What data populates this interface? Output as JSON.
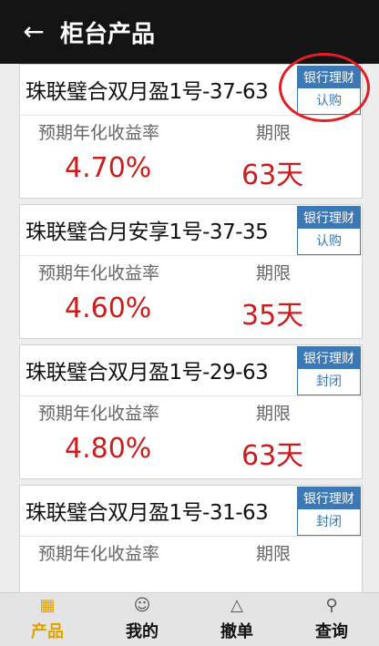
{
  "header": {
    "title": "柜台产品",
    "back_icon": "arrow-left-icon"
  },
  "products": [
    {
      "name": "珠联璧合双月盈1号-37-63",
      "tag_type": "银行理财",
      "tag_status": "认购",
      "rate_label": "预期年化收益率",
      "rate": "4.70%",
      "term_label": "期限",
      "term": "63天"
    },
    {
      "name": "珠联璧合月安享1号-37-35",
      "tag_type": "银行理财",
      "tag_status": "认购",
      "rate_label": "预期年化收益率",
      "rate": "4.60%",
      "term_label": "期限",
      "term": "35天"
    },
    {
      "name": "珠联璧合双月盈1号-29-63",
      "tag_type": "银行理财",
      "tag_status": "封闭",
      "rate_label": "预期年化收益率",
      "rate": "4.80%",
      "term_label": "期限",
      "term": "63天"
    },
    {
      "name": "珠联璧合双月盈1号-31-63",
      "tag_type": "银行理财",
      "tag_status": "封闭",
      "rate_label": "预期年化收益率",
      "rate": "",
      "term_label": "期限",
      "term": ""
    }
  ],
  "nav": [
    {
      "label": "产品",
      "icon": "grid-icon",
      "active": true
    },
    {
      "label": "我的",
      "icon": "person-icon",
      "active": false
    },
    {
      "label": "撤单",
      "icon": "withdraw-icon",
      "active": false
    },
    {
      "label": "查询",
      "icon": "search-icon",
      "active": false
    }
  ],
  "colors": {
    "accent": "#3c78b4",
    "value": "#cc1c1c",
    "nav_active": "#e0a100",
    "highlight": "#e21d24"
  }
}
